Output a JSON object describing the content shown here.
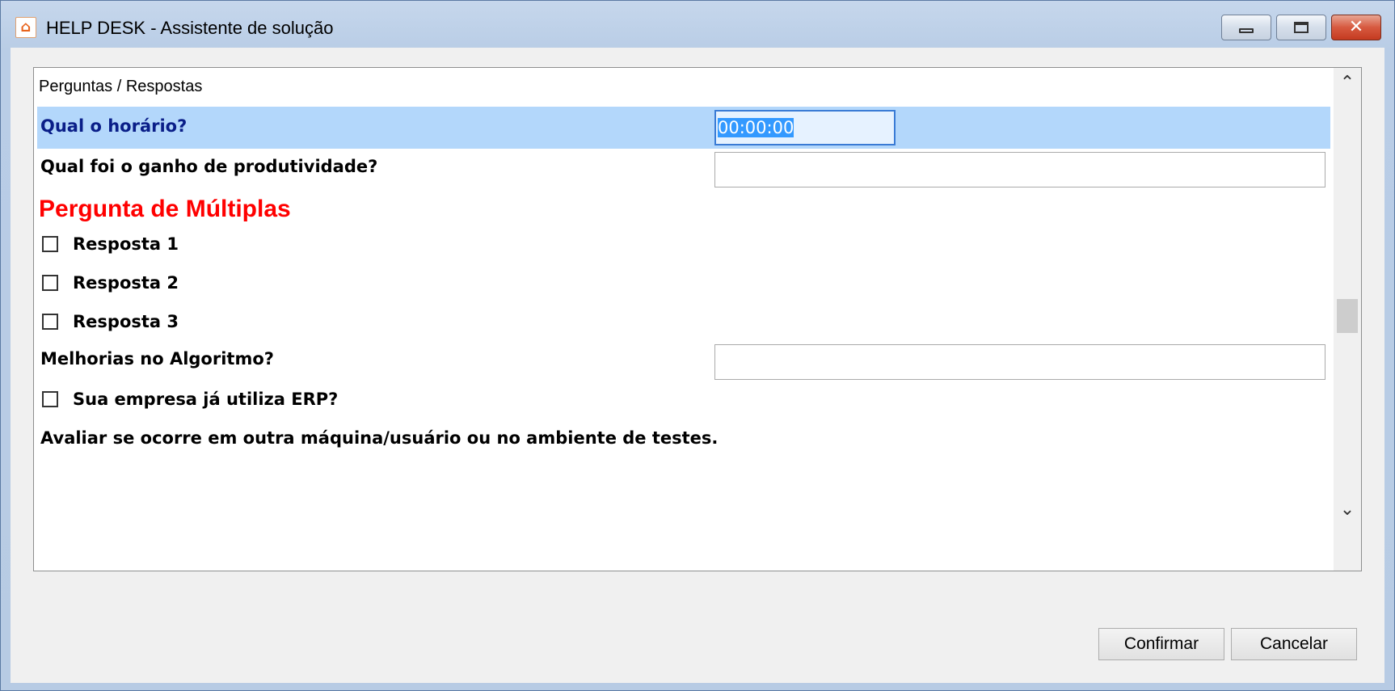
{
  "window": {
    "title": "HELP DESK - Assistente de solução",
    "icon": "helpdesk-app-icon",
    "controls": {
      "minimize": "minimize-icon",
      "maximize": "maximize-icon",
      "close": "close-icon"
    }
  },
  "panel": {
    "header": "Perguntas / Respostas",
    "questions": [
      {
        "label": "Qual o horário?",
        "value": "00:00:00",
        "selected": true
      },
      {
        "label": "Qual foi o ganho de produtividade?",
        "value": ""
      }
    ],
    "multiple": {
      "title": "Pergunta de Múltiplas",
      "options": [
        "Resposta 1",
        "Resposta 2",
        "Resposta 3"
      ]
    },
    "melhorias": {
      "label": "Melhorias no Algoritmo?",
      "value": ""
    },
    "erp_checkbox": "Sua empresa já utiliza ERP?",
    "note": "Avaliar se ocorre em outra máquina/usuário ou no ambiente de testes."
  },
  "buttons": {
    "confirm": "Confirmar",
    "cancel": "Cancelar"
  },
  "colors": {
    "section_title": "#ff0000",
    "selected_row": "#b3d7fb",
    "selected_label": "#0a1e88"
  }
}
